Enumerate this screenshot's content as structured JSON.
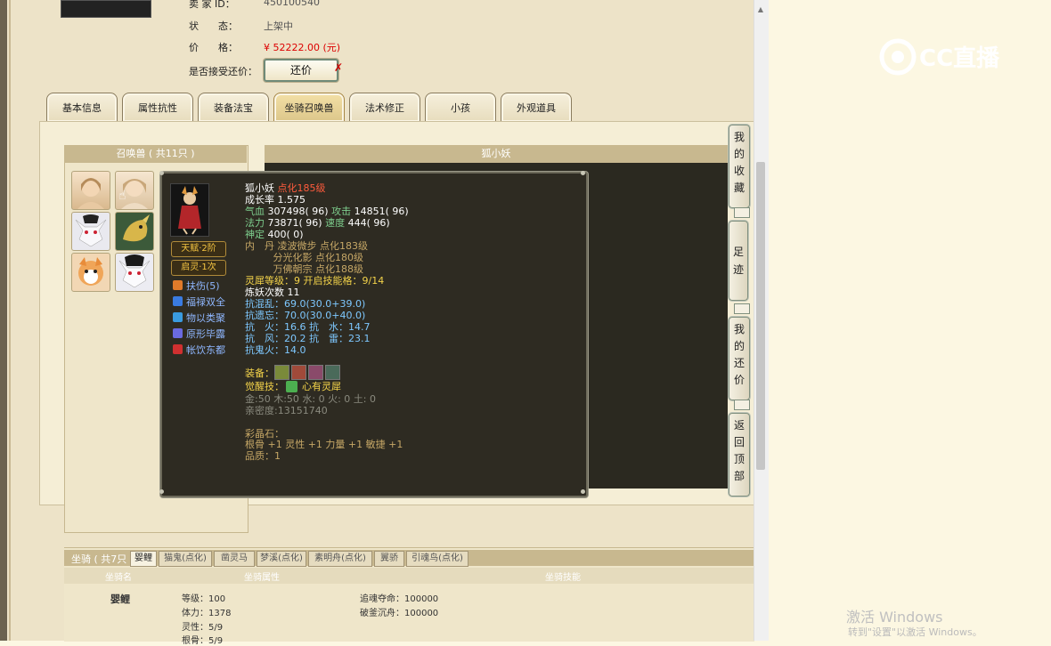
{
  "header": {
    "seller_id_label": "卖 家 ID：",
    "seller_id_value": "450100540",
    "status_label": "状　　态：",
    "status_value": "上架中",
    "price_label": "价　　格：",
    "price_value": "¥ 52222.00 (元)",
    "counter_label": "是否接受还价：",
    "counter_button": "还价",
    "counter_mark": "✗"
  },
  "tabs": [
    {
      "label": "基本信息",
      "active": false
    },
    {
      "label": "属性抗性",
      "active": false
    },
    {
      "label": "装备法宝",
      "active": false
    },
    {
      "label": "坐骑召唤兽",
      "active": true
    },
    {
      "label": "法术修正",
      "active": false
    },
    {
      "label": "小孩",
      "active": false
    },
    {
      "label": "外观道具",
      "active": false
    }
  ],
  "pet_list": {
    "header": "召唤兽 ( 共11只 )",
    "pets": [
      "pet-avatar-1",
      "pet-avatar-2",
      "pet-avatar-3",
      "pet-avatar-4",
      "pet-avatar-5",
      "pet-avatar-6"
    ]
  },
  "detail": {
    "title": "狐小妖"
  },
  "side_nav": {
    "favorites": "我的收藏",
    "footprint": "足迹",
    "my_counter": "我的还价",
    "back_top": "返回顶部"
  },
  "tooltip": {
    "name": "狐小妖",
    "name_suffix": "点化185级",
    "growth": "成长率 1.575",
    "hp_label": "气血 ",
    "hp_value": "307498( 96)",
    "atk_label": " 攻击 ",
    "atk_value": "14851( 96)",
    "mp_label": "法力 ",
    "mp_value": "73871( 96)",
    "spd_label": " 速度 ",
    "spd_value": "444( 96)",
    "def_label": "神定 ",
    "def_value": "400( 0)",
    "neidan_1": "内　丹 凌波微步 点化183级",
    "neidan_2": "         分光化影 点化180级",
    "neidan_3": "         万佛朝宗 点化188级",
    "lingxi": "灵犀等级：9 开启技能格：9/14",
    "lianyao": "炼妖次数 11",
    "resist_chaos": "抗混乱：69.0(30.0+39.0)",
    "resist_forget": "抗遗忘：70.0(30.0+40.0)",
    "resist_fire_water": "抗　火：16.6 抗　水：14.7",
    "resist_wind_thunder": "抗　风：20.2 抗　雷：23.1",
    "resist_ghost": "抗鬼火：14.0",
    "equip_label": "装备：",
    "awaken_label": "觉醒技：",
    "awaken_value": "心有灵犀",
    "elements": "金:50 木:50 水: 0 火: 0 土: 0",
    "intimacy": "亲密度:13151740",
    "shadow_label": "彩晶石：",
    "shadow_value": "根骨 +1 灵性 +1 力量 +1 敏捷 +1",
    "quality": "品质：1",
    "talent": "天赋·2阶",
    "qiling": "启灵·1次",
    "skills": [
      {
        "name": "扶伤(5)",
        "color": "#e07a2a"
      },
      {
        "name": "福禄双全",
        "color": "#3a7be0"
      },
      {
        "name": "物以类聚",
        "color": "#3a9be0"
      },
      {
        "name": "原形毕露",
        "color": "#6a6ae0"
      },
      {
        "name": "帐饮东都",
        "color": "#d03030"
      }
    ]
  },
  "mount": {
    "count_label": "坐骑 ( 共7只",
    "tabs": [
      {
        "label": "婴鲤",
        "active": true
      },
      {
        "label": "猫鬼(点化)",
        "active": false
      },
      {
        "label": "凿灵马",
        "active": false
      },
      {
        "label": "梦溪(点化)",
        "active": false
      },
      {
        "label": "素明舟(点化)",
        "active": false
      },
      {
        "label": "翼骄",
        "active": false
      },
      {
        "label": "引魂鸟(点化)",
        "active": false
      }
    ],
    "col_name": "坐骑名",
    "col_attr": "坐骑属性",
    "col_skill": "坐骑技能",
    "name": "婴鲤",
    "level": "等级：100",
    "stamina": "体力：1378",
    "spirit": "灵性：5/9",
    "bone": "根骨：5/9",
    "skill_1": "追魂夺命：100000",
    "skill_2": "破釜沉舟：100000"
  },
  "watermark": {
    "title": "激活 Windows",
    "subtitle": "转到\"设置\"以激活 Windows。"
  },
  "logo_text": "CC直播"
}
